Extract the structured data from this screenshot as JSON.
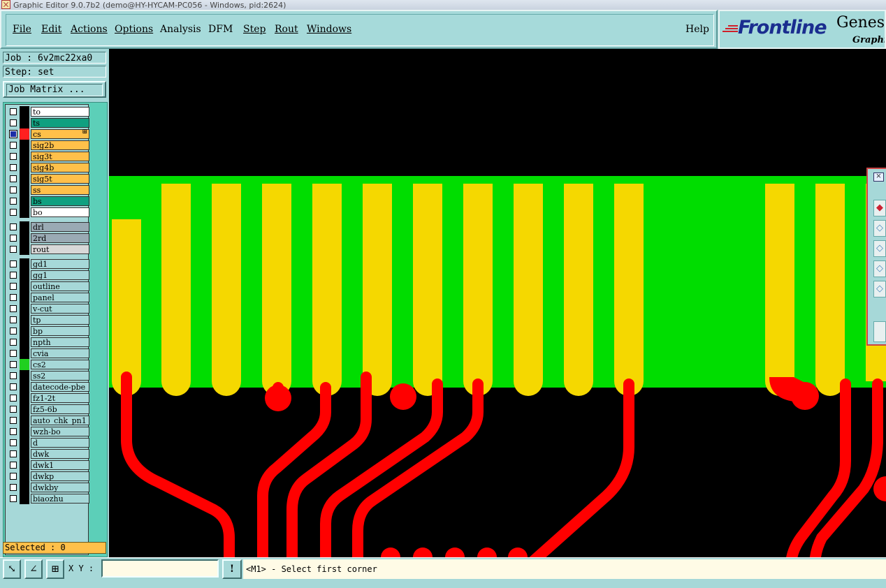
{
  "window": {
    "title": "Graphic Editor 9.0.7b2 (demo@HY-HYCAM-PC056 - Windows, pid:2624)"
  },
  "menu": {
    "items": [
      {
        "label": "File"
      },
      {
        "label": "Edit"
      },
      {
        "label": "Actions"
      },
      {
        "label": "Options"
      },
      {
        "label": "Analysis"
      },
      {
        "label": "DFM"
      },
      {
        "label": "Step"
      },
      {
        "label": "Rout"
      },
      {
        "label": "Windows"
      }
    ],
    "help": "Help"
  },
  "brand": {
    "logo": "Frontline",
    "product": "Genesis",
    "subtitle": "Graphic"
  },
  "job": {
    "label": "Job : 6v2mc22xa0",
    "step": "Step: set",
    "matrix_button": "Job Matrix ..."
  },
  "layers": [
    {
      "name": "to",
      "bg": "#ffffff",
      "color": "#000000",
      "checked": false,
      "marker": ""
    },
    {
      "name": "ts",
      "bg": "#10a080",
      "color": "#000000",
      "checked": false,
      "marker": ""
    },
    {
      "name": "cs",
      "bg": "#ffc04a",
      "color": "#ff2020",
      "checked": true,
      "marker": "⊞"
    },
    {
      "name": "sig2b",
      "bg": "#ffc04a",
      "color": "#000000",
      "checked": false,
      "marker": ""
    },
    {
      "name": "sig3t",
      "bg": "#ffc04a",
      "color": "#000000",
      "checked": false,
      "marker": ""
    },
    {
      "name": "sig4b",
      "bg": "#ffc04a",
      "color": "#000000",
      "checked": false,
      "marker": ""
    },
    {
      "name": "sig5t",
      "bg": "#ffc04a",
      "color": "#000000",
      "checked": false,
      "marker": ""
    },
    {
      "name": "ss",
      "bg": "#ffc04a",
      "color": "#000000",
      "checked": false,
      "marker": ""
    },
    {
      "name": "bs",
      "bg": "#10a080",
      "color": "#000000",
      "checked": false,
      "marker": ""
    },
    {
      "name": "bo",
      "bg": "#ffffff",
      "color": "#000000",
      "checked": false,
      "marker": ""
    },
    {
      "name": "drl",
      "bg": "#9aaab4",
      "color": "#000000",
      "checked": false,
      "marker": ""
    },
    {
      "name": "2rd",
      "bg": "#9aaab4",
      "color": "#000000",
      "checked": false,
      "marker": ""
    },
    {
      "name": "rout",
      "bg": "#d8d8d8",
      "color": "#000000",
      "checked": false,
      "marker": ""
    },
    {
      "name": "gd1",
      "bg": "#a6d8d8",
      "color": "#000000",
      "checked": false,
      "marker": ""
    },
    {
      "name": "gg1",
      "bg": "#a6d8d8",
      "color": "#000000",
      "checked": false,
      "marker": ""
    },
    {
      "name": "outline",
      "bg": "#a6d8d8",
      "color": "#000000",
      "checked": false,
      "marker": ""
    },
    {
      "name": "panel",
      "bg": "#a6d8d8",
      "color": "#000000",
      "checked": false,
      "marker": ""
    },
    {
      "name": "v-cut",
      "bg": "#a6d8d8",
      "color": "#000000",
      "checked": false,
      "marker": ""
    },
    {
      "name": "tp",
      "bg": "#a6d8d8",
      "color": "#000000",
      "checked": false,
      "marker": ""
    },
    {
      "name": "bp",
      "bg": "#a6d8d8",
      "color": "#000000",
      "checked": false,
      "marker": ""
    },
    {
      "name": "npth",
      "bg": "#a6d8d8",
      "color": "#000000",
      "checked": false,
      "marker": ""
    },
    {
      "name": "cvia",
      "bg": "#a6d8d8",
      "color": "#000000",
      "checked": false,
      "marker": ""
    },
    {
      "name": "cs2",
      "bg": "#a6d8d8",
      "color": "#20d020",
      "checked": false,
      "marker": ""
    },
    {
      "name": "ss2",
      "bg": "#a6d8d8",
      "color": "#000000",
      "checked": false,
      "marker": ""
    },
    {
      "name": "datecode-pbe",
      "bg": "#a6d8d8",
      "color": "#000000",
      "checked": false,
      "marker": ""
    },
    {
      "name": "fz1-2t",
      "bg": "#a6d8d8",
      "color": "#000000",
      "checked": false,
      "marker": ""
    },
    {
      "name": "fz5-6b",
      "bg": "#a6d8d8",
      "color": "#000000",
      "checked": false,
      "marker": ""
    },
    {
      "name": "auto_chk_pn1",
      "bg": "#a6d8d8",
      "color": "#000000",
      "checked": false,
      "marker": ""
    },
    {
      "name": "wzh-bo",
      "bg": "#a6d8d8",
      "color": "#000000",
      "checked": false,
      "marker": ""
    },
    {
      "name": "d",
      "bg": "#a6d8d8",
      "color": "#000000",
      "checked": false,
      "marker": ""
    },
    {
      "name": "dwk",
      "bg": "#a6d8d8",
      "color": "#000000",
      "checked": false,
      "marker": ""
    },
    {
      "name": "dwk1",
      "bg": "#a6d8d8",
      "color": "#000000",
      "checked": false,
      "marker": ""
    },
    {
      "name": "dwkp",
      "bg": "#a6d8d8",
      "color": "#000000",
      "checked": false,
      "marker": ""
    },
    {
      "name": "dwkby",
      "bg": "#a6d8d8",
      "color": "#000000",
      "checked": false,
      "marker": ""
    },
    {
      "name": "biaozhu",
      "bg": "#a6d8d8",
      "color": "#000000",
      "checked": false,
      "marker": ""
    }
  ],
  "selected": "Selected : 0",
  "bottom": {
    "xy_label": "X Y :",
    "xy_value": "",
    "warn_icon": "!",
    "message": "<M1> - Select first corner"
  },
  "icons": {
    "zoom": "zoom-box-icon",
    "measure": "measure-icon",
    "grid": "grid-icon"
  },
  "colors": {
    "copper_fill": "#00dd00",
    "fingers": "#f5d800",
    "traces": "#ff0000",
    "background": "#000000"
  }
}
